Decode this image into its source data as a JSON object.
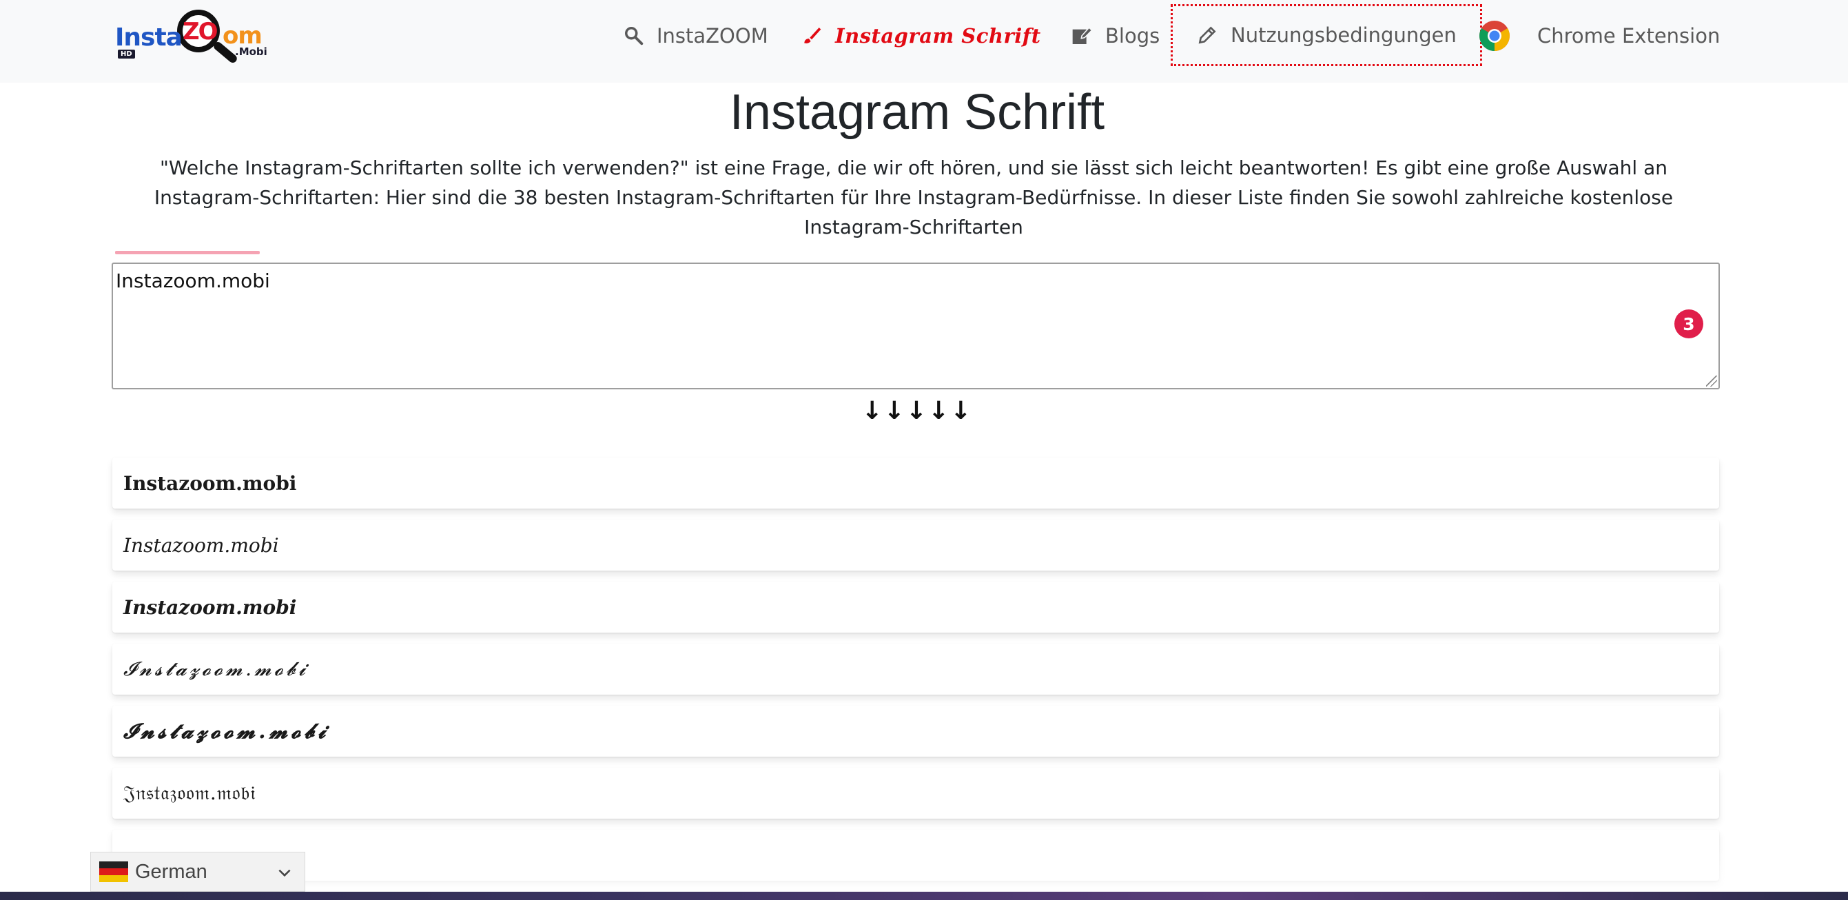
{
  "nav": {
    "items": [
      {
        "label": "InstaZOOM",
        "icon": "search-icon"
      },
      {
        "label": "Instagram Schrift",
        "icon": "brush-icon"
      },
      {
        "label": "Blogs",
        "icon": "edit-square-icon"
      },
      {
        "label": "Nutzungsbedingungen",
        "icon": "pencil-icon"
      },
      {
        "label": "Chrome Extension",
        "icon": "chrome-icon"
      }
    ],
    "active_color": "#e20a13"
  },
  "logo": {
    "text_insta": "Insta",
    "text_zo": "ZO",
    "text_om": "om",
    "text_mobi": ".Mobi",
    "text_hd": "HD"
  },
  "page": {
    "title": "Instagram Schrift",
    "intro": "\"Welche Instagram-Schriftarten sollte ich verwenden?\" ist eine Frage, die wir oft hören, und sie lässt sich leicht beantworten! Es gibt eine große Auswahl an Instagram-Schriftarten: Hier sind die 38 besten Instagram-Schriftarten für Ihre Instagram-Bedürfnisse. In dieser Liste finden Sie sowohl zahlreiche kostenlose Instagram-Schriftarten"
  },
  "input": {
    "value": "Instazoom.mobi",
    "badge": "3"
  },
  "arrows": "↓↓↓↓↓",
  "results": [
    "Instazoom.mobi",
    "𝐼𝑛𝑠𝑡𝑎𝑧𝑜𝑜𝑚.𝑚𝑜𝑏𝑖",
    "𝑰𝒏𝒔𝒕𝒂𝒛𝒐𝒐𝒎.𝒎𝒐𝒃𝒊",
    "𝓘𝓷𝓼𝓽𝓪𝔃𝓸𝓸𝓶.𝓶𝓸𝓫𝓲",
    "𝓘𝓷𝓼𝓽𝓪𝔃𝓸𝓸𝓶.𝓶𝓸𝓫𝓲",
    "𝔍𝔫𝔰𝔱𝔞𝔷𝔬𝔬𝔪.𝔪𝔬𝔟𝔦",
    "Instazoom.mobi"
  ],
  "language": {
    "selected": "German"
  },
  "colors": {
    "accent": "#e20a13",
    "badge": "#e01e4a",
    "pink_line": "#f5a3b3"
  }
}
